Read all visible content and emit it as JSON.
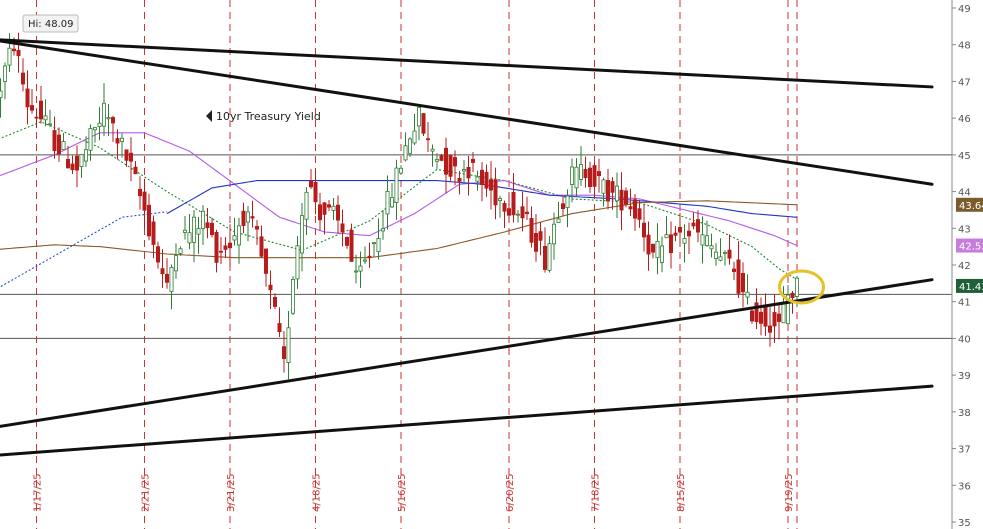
{
  "chart_data": {
    "type": "candlestick",
    "title": "10yr Treasury Yield",
    "hi_label": "Hi: 48.09",
    "ylim": [
      35,
      49
    ],
    "y_ticks": [
      "35",
      "36",
      "37",
      "38",
      "39",
      "40",
      "41",
      "42",
      "43",
      "44",
      "45",
      "46",
      "47",
      "48",
      "49"
    ],
    "grid": "vertical dashed red at weekly date markers",
    "date_labels": [
      "1/17/25",
      "2/21/25",
      "3/21/25",
      "4/18/25",
      "5/16/25",
      "6/20/25",
      "7/18/25",
      "8/15/25",
      "9/19/25"
    ],
    "date_label_index": [
      11,
      35,
      54,
      73,
      92,
      116,
      135,
      154,
      178
    ],
    "bar_count": 181,
    "price_tags": [
      {
        "label": "43.64",
        "value": 43.64,
        "color": "#7a5c2e"
      },
      {
        "label": "42.53",
        "value": 42.53,
        "color": "#c77ddb"
      },
      {
        "label": "41.43",
        "value": 41.43,
        "color": "#1f5f3a"
      }
    ],
    "horizontal_levels": [
      45.0,
      41.2,
      40.0
    ],
    "trendlines": [
      {
        "from": [
          0,
          48.15
        ],
        "to": [
          210,
          46.85
        ]
      },
      {
        "from": [
          3,
          48.1
        ],
        "to": [
          210,
          44.2
        ]
      },
      {
        "from": [
          0,
          37.55
        ],
        "to": [
          210,
          41.6
        ]
      },
      {
        "from": [
          0,
          36.8
        ],
        "to": [
          210,
          38.7
        ]
      }
    ],
    "highlight": {
      "index": 181,
      "value": 41.4,
      "color": "#e6c12a"
    },
    "anchors": [
      [
        0,
        45.6
      ],
      [
        4,
        47.3
      ],
      [
        6,
        48.05
      ],
      [
        9,
        46.4
      ],
      [
        12,
        46.0
      ],
      [
        16,
        45.2
      ],
      [
        20,
        44.6
      ],
      [
        23,
        45.4
      ],
      [
        26,
        46.2
      ],
      [
        29,
        45.5
      ],
      [
        32,
        44.6
      ],
      [
        35,
        43.5
      ],
      [
        37,
        42.6
      ],
      [
        40,
        41.3
      ],
      [
        42,
        42.6
      ],
      [
        45,
        42.9
      ],
      [
        48,
        43.3
      ],
      [
        51,
        42.4
      ],
      [
        54,
        42.6
      ],
      [
        57,
        43.4
      ],
      [
        60,
        42.7
      ],
      [
        62,
        41.6
      ],
      [
        64,
        40.6
      ],
      [
        66,
        39.2
      ],
      [
        68,
        41.8
      ],
      [
        71,
        44.3
      ],
      [
        74,
        43.5
      ],
      [
        77,
        43.3
      ],
      [
        80,
        42.7
      ],
      [
        82,
        41.5
      ],
      [
        85,
        42.3
      ],
      [
        88,
        43.3
      ],
      [
        91,
        44.4
      ],
      [
        94,
        45.6
      ],
      [
        96,
        46.0
      ],
      [
        98,
        45.3
      ],
      [
        101,
        44.9
      ],
      [
        104,
        44.5
      ],
      [
        107,
        44.7
      ],
      [
        110,
        44.2
      ],
      [
        113,
        43.9
      ],
      [
        116,
        43.7
      ],
      [
        119,
        43.3
      ],
      [
        122,
        42.7
      ],
      [
        124,
        42.2
      ],
      [
        127,
        43.6
      ],
      [
        130,
        44.4
      ],
      [
        133,
        44.6
      ],
      [
        136,
        44.2
      ],
      [
        139,
        43.9
      ],
      [
        142,
        43.8
      ],
      [
        145,
        43.3
      ],
      [
        148,
        42.2
      ],
      [
        151,
        42.5
      ],
      [
        154,
        42.8
      ],
      [
        157,
        42.9
      ],
      [
        160,
        42.6
      ],
      [
        163,
        42.2
      ],
      [
        166,
        41.9
      ],
      [
        168,
        41.1
      ],
      [
        171,
        40.6
      ],
      [
        174,
        40.5
      ],
      [
        176,
        40.3
      ],
      [
        178,
        41.2
      ],
      [
        180,
        41.4
      ]
    ],
    "ma_series": [
      {
        "name": "",
        "color": "#1a8a2a",
        "dashed": true,
        "points": [
          [
            0,
            45.3
          ],
          [
            12,
            45.9
          ],
          [
            25,
            45.2
          ],
          [
            40,
            44.0
          ],
          [
            55,
            42.9
          ],
          [
            70,
            42.4
          ],
          [
            85,
            43.2
          ],
          [
            100,
            44.6
          ],
          [
            115,
            44.3
          ],
          [
            130,
            43.8
          ],
          [
            145,
            43.7
          ],
          [
            160,
            43.1
          ],
          [
            170,
            42.5
          ],
          [
            176,
            41.9
          ],
          [
            180,
            41.6
          ]
        ]
      },
      {
        "name": "",
        "color": "#b45be8",
        "dashed": false,
        "points": [
          [
            0,
            44.3
          ],
          [
            15,
            45.0
          ],
          [
            25,
            45.6
          ],
          [
            35,
            45.6
          ],
          [
            45,
            45.1
          ],
          [
            55,
            44.2
          ],
          [
            65,
            43.3
          ],
          [
            75,
            42.9
          ],
          [
            85,
            42.8
          ],
          [
            95,
            43.4
          ],
          [
            105,
            44.2
          ],
          [
            115,
            44.3
          ],
          [
            125,
            43.9
          ],
          [
            135,
            43.9
          ],
          [
            145,
            43.8
          ],
          [
            155,
            43.5
          ],
          [
            165,
            43.2
          ],
          [
            175,
            42.8
          ],
          [
            180,
            42.53
          ]
        ]
      },
      {
        "name": "",
        "color": "#1f36c8",
        "dashed": false,
        "points": [
          [
            40,
            43.4
          ],
          [
            50,
            44.1
          ],
          [
            60,
            44.3
          ],
          [
            75,
            44.3
          ],
          [
            90,
            44.3
          ],
          [
            100,
            44.3
          ],
          [
            110,
            44.2
          ],
          [
            125,
            43.9
          ],
          [
            140,
            43.8
          ],
          [
            150,
            43.7
          ],
          [
            160,
            43.6
          ],
          [
            170,
            43.4
          ],
          [
            180,
            43.3
          ]
        ]
      },
      {
        "name": "",
        "color": "#2b4fcf",
        "dashed": true,
        "points": [
          [
            0,
            41.2
          ],
          [
            10,
            41.9
          ],
          [
            20,
            42.6
          ],
          [
            30,
            43.3
          ],
          [
            40,
            43.45
          ]
        ]
      },
      {
        "name": "",
        "color": "#8b5a2b",
        "dashed": false,
        "points": [
          [
            0,
            42.4
          ],
          [
            15,
            42.55
          ],
          [
            25,
            42.5
          ],
          [
            40,
            42.3
          ],
          [
            55,
            42.2
          ],
          [
            70,
            42.2
          ],
          [
            85,
            42.2
          ],
          [
            100,
            42.45
          ],
          [
            115,
            42.9
          ],
          [
            130,
            43.4
          ],
          [
            145,
            43.7
          ],
          [
            160,
            43.75
          ],
          [
            180,
            43.64
          ]
        ]
      }
    ]
  }
}
